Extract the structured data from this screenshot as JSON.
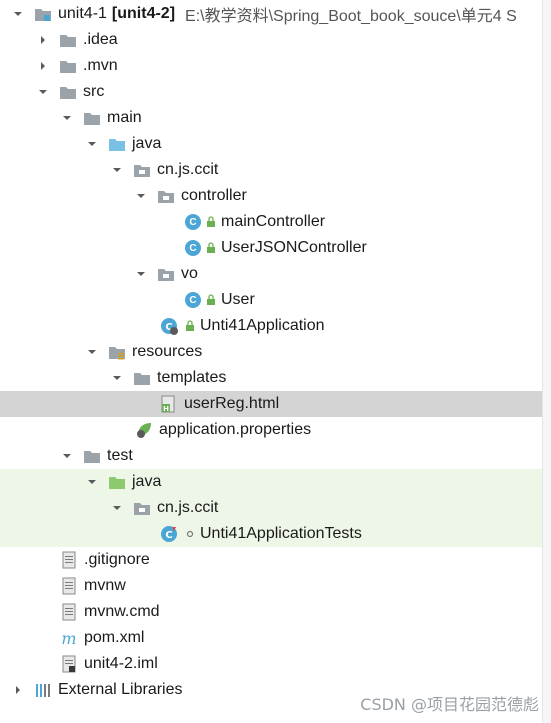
{
  "tree": {
    "project": {
      "name": "unit4-1",
      "module": "[unit4-2]",
      "path": "E:\\教学资料\\Spring_Boot_book_souce\\单元4 S"
    },
    "items": {
      "idea": ".idea",
      "mvn": ".mvn",
      "src": "src",
      "main": "main",
      "java_main": "java",
      "pkg_main": "cn.js.ccit",
      "controller": "controller",
      "main_controller": "mainController",
      "user_json_controller": "UserJSONController",
      "vo": "vo",
      "user": "User",
      "app": "Unti41Application",
      "resources": "resources",
      "templates": "templates",
      "user_reg": "userReg.html",
      "app_props": "application.properties",
      "test": "test",
      "java_test": "java",
      "pkg_test": "cn.js.ccit",
      "app_tests": "Unti41ApplicationTests",
      "gitignore": ".gitignore",
      "mvnw": "mvnw",
      "mvnw_cmd": "mvnw.cmd",
      "pom": "pom.xml",
      "iml": "unit4-2.iml",
      "external": "External Libraries"
    }
  },
  "watermark": "CSDN @项目花园范德彪",
  "colors": {
    "selection": "#d4d4d4",
    "test_bg": "#eef6e8",
    "class_icon": "#4ba6d6",
    "folder_gray": "#9aa3aa",
    "folder_blue": "#79c0e3",
    "folder_green": "#8cc96f"
  }
}
